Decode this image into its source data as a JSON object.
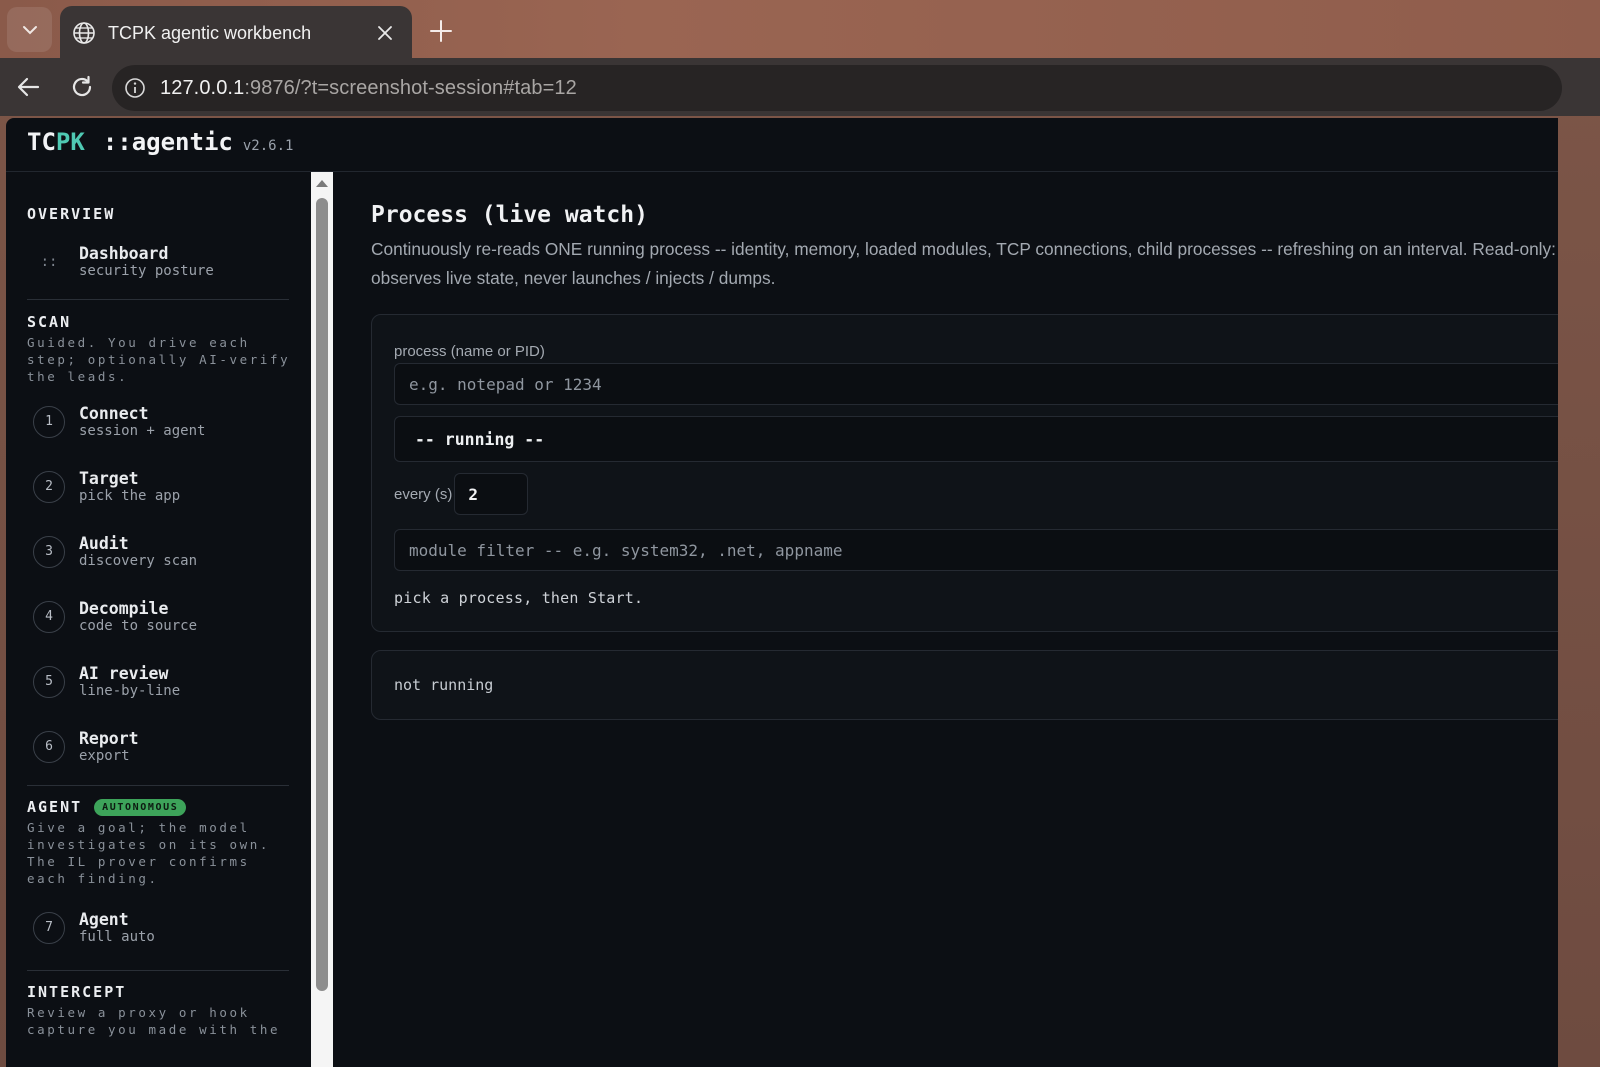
{
  "browser": {
    "tab_title": "TCPK agentic workbench",
    "url_host": "127.0.0.1",
    "url_rest": ":9876/?t=screenshot-session#tab=12"
  },
  "app": {
    "brand_a": "TC",
    "brand_b": "PK",
    "brand_suffix": "::agentic",
    "version": "v2.6.1"
  },
  "sidebar": {
    "overview": {
      "title": "OVERVIEW",
      "items": [
        {
          "glyph": "::",
          "label": "Dashboard",
          "sub": "security posture"
        }
      ]
    },
    "scan": {
      "title": "SCAN",
      "desc": "Guided. You drive each step; optionally AI-verify the leads.",
      "items": [
        {
          "num": "1",
          "label": "Connect",
          "sub": "session + agent"
        },
        {
          "num": "2",
          "label": "Target",
          "sub": "pick the app"
        },
        {
          "num": "3",
          "label": "Audit",
          "sub": "discovery scan"
        },
        {
          "num": "4",
          "label": "Decompile",
          "sub": "code to source"
        },
        {
          "num": "5",
          "label": "AI review",
          "sub": "line-by-line"
        },
        {
          "num": "6",
          "label": "Report",
          "sub": "export"
        }
      ]
    },
    "agent": {
      "title": "AGENT",
      "badge": "AUTONOMOUS",
      "desc": "Give a goal; the model investigates on its own. The IL prover confirms each finding.",
      "items": [
        {
          "num": "7",
          "label": "Agent",
          "sub": "full auto"
        }
      ]
    },
    "intercept": {
      "title": "INTERCEPT",
      "desc": "Review a proxy or hook capture you made with the"
    }
  },
  "main": {
    "title": "Process (live watch)",
    "desc": "Continuously re-reads ONE running process -- identity, memory, loaded modules, TCP connections, child processes -- refreshing on an interval. Read-only: it observes live state, never launches / injects / dumps.",
    "process_label": "process (name or PID)",
    "process_placeholder": "e.g. notepad or 1234",
    "process_select": "-- running --",
    "every_label": "every (s)",
    "every_value": "2",
    "filter_placeholder": "module filter -- e.g. system32, .net, appname",
    "hint": "pick a process, then Start.",
    "status": "not running"
  },
  "colors": {
    "accent": "#4fc9b3",
    "badge": "#3da35a",
    "background": "#0c0f14"
  }
}
